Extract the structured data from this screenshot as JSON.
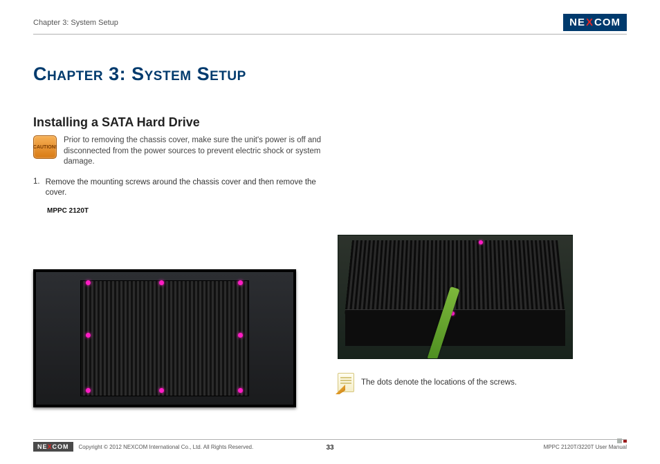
{
  "header": {
    "breadcrumb": "Chapter 3: System Setup",
    "logo_text_pre": "NE",
    "logo_text_x": "X",
    "logo_text_post": "COM"
  },
  "chapter_title": "Chapter 3: System Setup",
  "section_heading": "Installing a SATA Hard Drive",
  "caution": {
    "icon_label": "CAUTION!",
    "text": "Prior to removing the chassis cover, make sure the unit's power is off and disconnected from the power sources to prevent electric shock or system damage."
  },
  "steps": [
    {
      "num": "1.",
      "text": "Remove the mounting screws around the chassis cover and then remove the cover."
    }
  ],
  "model_label": "MPPC 2120T",
  "note_text": "The dots denote the locations of the screws.",
  "footer": {
    "logo_pre": "NE",
    "logo_x": "X",
    "logo_post": "COM",
    "copyright": "Copyright © 2012 NEXCOM International Co., Ltd. All Rights Reserved.",
    "page_number": "33",
    "doc_ref": "MPPC 2120T/3220T User Manual"
  }
}
